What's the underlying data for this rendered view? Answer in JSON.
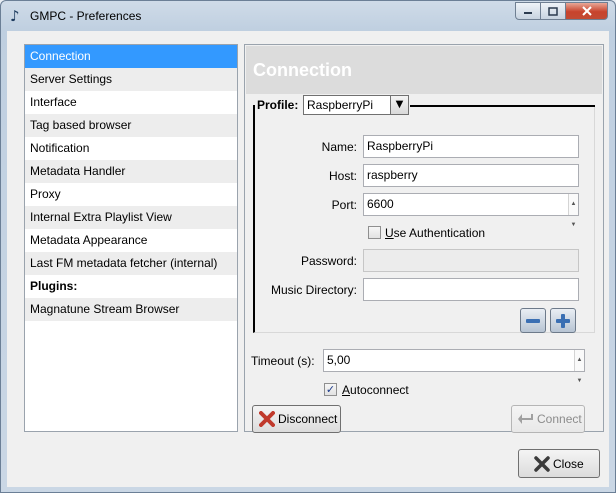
{
  "window": {
    "title": "GMPC - Preferences"
  },
  "sidebar": {
    "items": [
      {
        "label": "Connection",
        "selected": true
      },
      {
        "label": "Server Settings"
      },
      {
        "label": "Interface"
      },
      {
        "label": "Tag based browser"
      },
      {
        "label": "Notification"
      },
      {
        "label": "Metadata Handler"
      },
      {
        "label": "Proxy"
      },
      {
        "label": "Internal Extra Playlist View"
      },
      {
        "label": "Metadata Appearance"
      },
      {
        "label": "Last FM metadata fetcher (internal)"
      },
      {
        "label": "Plugins:"
      },
      {
        "label": "Magnatune Stream Browser"
      }
    ]
  },
  "panel": {
    "title": "Connection",
    "profile": {
      "label": "Profile:",
      "value": "RaspberryPi"
    },
    "fields": {
      "name": {
        "label": "Name:",
        "value": "RaspberryPi"
      },
      "host": {
        "label": "Host:",
        "value": "raspberry"
      },
      "port": {
        "label": "Port:",
        "value": "6600"
      },
      "use_auth": {
        "label": "Use Authentication",
        "checked": false
      },
      "password": {
        "label": "Password:",
        "value": ""
      },
      "music_dir": {
        "label": "Music Directory:",
        "value": ""
      }
    },
    "timeout": {
      "label": "Timeout (s):",
      "value": "5,00"
    },
    "autoconnect": {
      "label": "Autoconnect",
      "checked": true
    },
    "disconnect_label": "Disconnect",
    "connect_label": "Connect"
  },
  "footer": {
    "close_label": "Close"
  },
  "colors": {
    "selection": "#3399ff",
    "close_caption": "#c8432c"
  },
  "icons": [
    "music-note-icon",
    "minimize-icon",
    "maximize-icon",
    "close-icon",
    "remove-icon",
    "add-icon",
    "disconnect-icon",
    "connect-icon",
    "dropdown-arrow-icon"
  ]
}
